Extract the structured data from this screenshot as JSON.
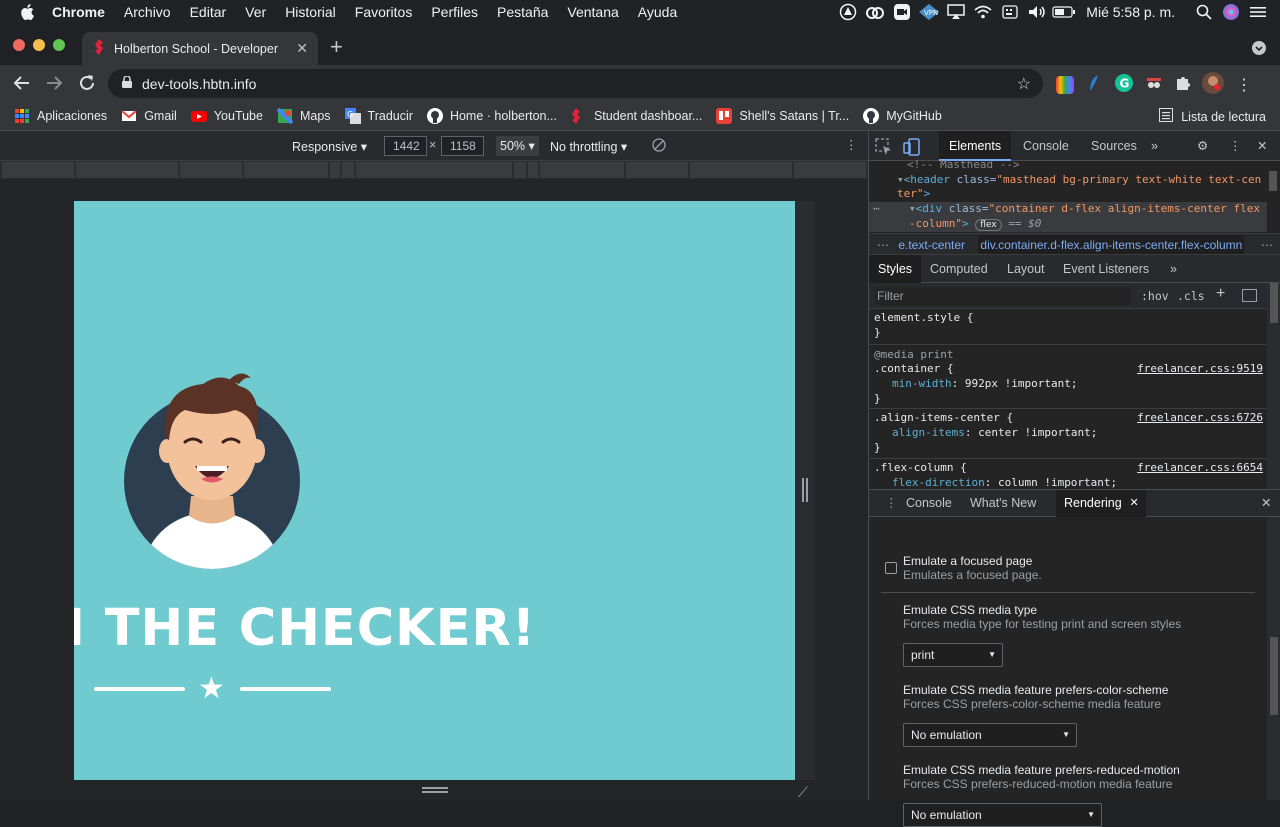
{
  "menubar": {
    "items": [
      "Chrome",
      "Archivo",
      "Editar",
      "Ver",
      "Historial",
      "Favoritos",
      "Perfiles",
      "Pestaña",
      "Ventana",
      "Ayuda"
    ],
    "clock": "Mié 5:58 p. m."
  },
  "tab": {
    "title": "Holberton School - Developer t",
    "new_tab": "+"
  },
  "omnibox": {
    "url": "dev-tools.hbtn.info"
  },
  "bookmarks": {
    "items": [
      "Aplicaciones",
      "Gmail",
      "YouTube",
      "Maps",
      "Traducir",
      "Home · holberton...",
      "Student dashboar...",
      "Shell's Satans | Tr...",
      "MyGitHub"
    ],
    "reading_list": "Lista de lectura"
  },
  "device_toolbar": {
    "mode": "Responsive",
    "width": "1442",
    "height": "1158",
    "zoom": "50%",
    "throttling": "No throttling"
  },
  "page": {
    "heading": "I THE CHECKER!"
  },
  "devtools": {
    "tabs": [
      "Elements",
      "Console",
      "Sources"
    ],
    "dom": {
      "comment": "<!-- Masthead -->",
      "header_tag": "<header",
      "header_attr": " class=",
      "header_val": "\"masthead bg-primary text-white text-cen",
      "header_val2": "ter\"",
      "header_close": ">",
      "div_tag": "<div",
      "div_attr": " class=",
      "div_val": "\"container d-flex align-items-center flex",
      "div_val2": "-column\"",
      "div_close": ">",
      "flex_badge": "flex",
      "eq": "== $0"
    },
    "breadcrumbs": [
      "e.text-center",
      "div.container.d-flex.align-items-center.flex-column"
    ],
    "styles_tabs": [
      "Styles",
      "Computed",
      "Layout",
      "Event Listeners"
    ],
    "filter_placeholder": "Filter",
    "hov": ":hov",
    "cls": ".cls",
    "rules": {
      "element_style": "element.style {",
      "close": "}",
      "media": "@media print",
      "container_sel": ".container {",
      "container_prop": "min-width",
      "container_val": ": 992px !important;",
      "container_src": "freelancer.css:9519",
      "align_sel": ".align-items-center {",
      "align_prop": "align-items",
      "align_val": ": center !important;",
      "align_src": "freelancer.css:6726",
      "flex_sel": ".flex-column {",
      "flex_prop": "flex-direction",
      "flex_val": ": column !important;",
      "flex_src": "freelancer.css:6654"
    },
    "drawer_tabs": [
      "Console",
      "What's New",
      "Rendering"
    ],
    "rendering": {
      "focused_title": "Emulate a focused page",
      "focused_desc": "Emulates a focused page.",
      "media_type_title": "Emulate CSS media type",
      "media_type_desc": "Forces media type for testing print and screen styles",
      "media_type_value": "print",
      "color_scheme_title": "Emulate CSS media feature prefers-color-scheme",
      "color_scheme_desc": "Forces CSS prefers-color-scheme media feature",
      "color_scheme_value": "No emulation",
      "reduced_motion_title": "Emulate CSS media feature prefers-reduced-motion",
      "reduced_motion_desc": "Forces CSS prefers-reduced-motion media feature",
      "reduced_motion_value": "No emulation"
    }
  },
  "colors": {
    "page_bg": "#70cbd1",
    "accent": "#7cacf8"
  }
}
